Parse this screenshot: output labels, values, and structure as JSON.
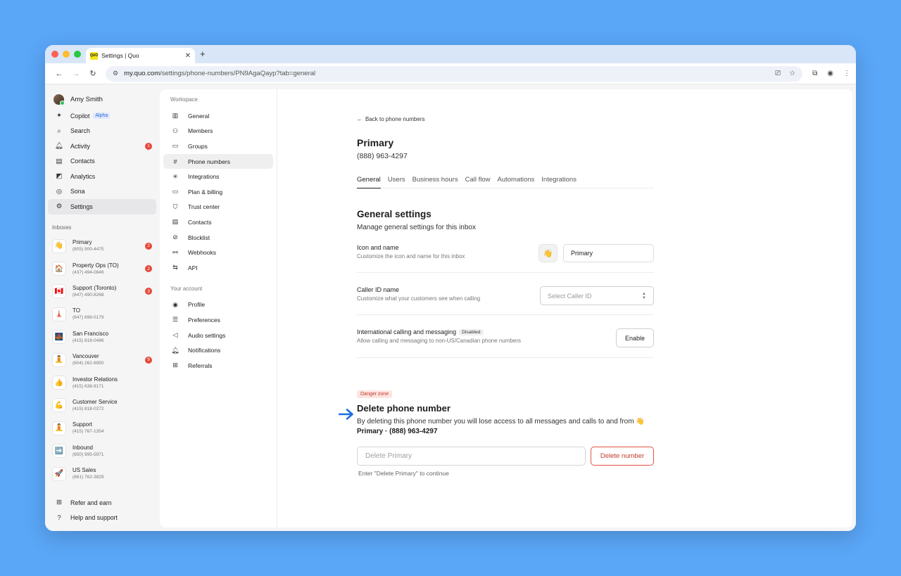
{
  "browser": {
    "tab_title": "Settings | Quo",
    "favicon_text": "QUO",
    "url_host": "my.quo.com",
    "url_path": "/settings/phone-numbers/PN9AgaQayp?tab=general"
  },
  "sidebar": {
    "user_name": "Amy Smith",
    "nav": [
      {
        "label": "Copilot",
        "icon": "sparkle-icon",
        "badge": "Alpha"
      },
      {
        "label": "Search",
        "icon": "search-icon"
      },
      {
        "label": "Activity",
        "icon": "bell-icon",
        "count": "1"
      },
      {
        "label": "Contacts",
        "icon": "contacts-icon"
      },
      {
        "label": "Analytics",
        "icon": "analytics-icon"
      },
      {
        "label": "Sona",
        "icon": "sona-icon"
      },
      {
        "label": "Settings",
        "icon": "gear-icon"
      }
    ],
    "inboxes_label": "Inboxes",
    "inboxes": [
      {
        "name": "Primary",
        "number": "(805) 900-4475",
        "emoji": "👋",
        "count": "2"
      },
      {
        "name": "Property Ops (TO)",
        "number": "(437) 494-0646",
        "emoji": "🏠",
        "count": "2"
      },
      {
        "name": "Support (Toronto)",
        "number": "(647) 490-8268",
        "emoji": "🇨🇦",
        "count": "3"
      },
      {
        "name": "TO",
        "number": "(647) 699-0179",
        "emoji": "🗼",
        "count": ""
      },
      {
        "name": "San Francisco",
        "number": "(415) 818-0486",
        "emoji": "🌉",
        "count": ""
      },
      {
        "name": "Vancouver",
        "number": "(604) 262-6950",
        "emoji": "🧘",
        "count": "9"
      },
      {
        "name": "Investor Relations",
        "number": "(415) 638-9171",
        "emoji": "👍",
        "count": ""
      },
      {
        "name": "Customer Service",
        "number": "(415) 818-0272",
        "emoji": "💪",
        "count": ""
      },
      {
        "name": "Support",
        "number": "(415) 767-1354",
        "emoji": "🧘",
        "count": ""
      },
      {
        "name": "Inbound",
        "number": "(650) 995-5971",
        "emoji": "➡️",
        "count": ""
      },
      {
        "name": "US Sales",
        "number": "(661) 762-3829",
        "emoji": "🚀",
        "count": ""
      }
    ],
    "footer": [
      {
        "label": "Refer and earn",
        "icon": "gift-icon"
      },
      {
        "label": "Help and support",
        "icon": "help-icon"
      }
    ]
  },
  "subnav": {
    "workspace_label": "Workspace",
    "workspace": [
      {
        "label": "General",
        "icon": "building-icon"
      },
      {
        "label": "Members",
        "icon": "members-icon"
      },
      {
        "label": "Groups",
        "icon": "folder-icon"
      },
      {
        "label": "Phone numbers",
        "icon": "hash-icon"
      },
      {
        "label": "Integrations",
        "icon": "integrations-icon"
      },
      {
        "label": "Plan & billing",
        "icon": "card-icon"
      },
      {
        "label": "Trust center",
        "icon": "shield-icon"
      },
      {
        "label": "Contacts",
        "icon": "contacts-icon"
      },
      {
        "label": "Blocklist",
        "icon": "block-icon"
      },
      {
        "label": "Webhooks",
        "icon": "webhook-icon"
      },
      {
        "label": "API",
        "icon": "api-icon"
      }
    ],
    "account_label": "Your account",
    "account": [
      {
        "label": "Profile",
        "icon": "profile-icon"
      },
      {
        "label": "Preferences",
        "icon": "sliders-icon"
      },
      {
        "label": "Audio settings",
        "icon": "speaker-icon"
      },
      {
        "label": "Notifications",
        "icon": "bell-icon"
      },
      {
        "label": "Referrals",
        "icon": "gift-icon"
      }
    ]
  },
  "main": {
    "back_label": "Back to phone numbers",
    "title": "Primary",
    "phone": "(888) 963-4297",
    "tabs": [
      "General",
      "Users",
      "Business hours",
      "Call flow",
      "Automations",
      "Integrations"
    ],
    "section_title": "General settings",
    "section_desc": "Manage general settings for this inbox",
    "icon_name": {
      "title": "Icon and name",
      "desc": "Customize the icon and name for this inbox",
      "emoji": "👋",
      "value": "Primary"
    },
    "caller_id": {
      "title": "Caller ID name",
      "desc": "Customize what your customers see when calling",
      "placeholder": "Select Caller ID"
    },
    "international": {
      "title": "International calling and messaging",
      "badge": "Disabled",
      "desc": "Allow calling and messaging to non-US/Canadian phone numbers",
      "button": "Enable"
    },
    "danger": {
      "badge": "Danger zone",
      "title": "Delete phone number",
      "desc_prefix": "By deleting this phone number you will lose access to all messages and calls to and from",
      "desc_emoji": "👋",
      "desc_name": "Primary · (888) 963-4297",
      "input_placeholder": "Delete Primary",
      "button": "Delete number",
      "hint": "Enter \"Delete Primary\" to continue"
    }
  },
  "colors": {
    "accent_arrow": "#1f6fe0",
    "danger": "#c23a2c",
    "background": "#5aa6f7"
  }
}
